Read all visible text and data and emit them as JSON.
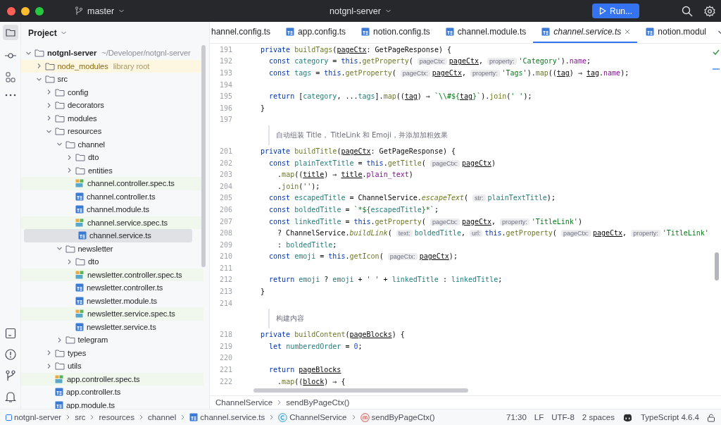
{
  "window": {
    "branch": "master",
    "project": "notgnl-server",
    "run_button": "Run..."
  },
  "project_panel": {
    "title": "Project",
    "tree": [
      {
        "name": "notgnl-server",
        "kind": "project",
        "hint": "~/Developer/notgnl-server",
        "expanded": true,
        "selected": false,
        "children": [
          {
            "name": "node_modules",
            "kind": "library",
            "hint": "library root",
            "expanded": false,
            "selected": false
          },
          {
            "name": "src",
            "kind": "folder",
            "expanded": true,
            "selected": false,
            "children": [
              {
                "name": "config",
                "kind": "folder",
                "expanded": false,
                "selected": false
              },
              {
                "name": "decorators",
                "kind": "folder",
                "expanded": false,
                "selected": false
              },
              {
                "name": "modules",
                "kind": "folder",
                "expanded": false,
                "selected": false
              },
              {
                "name": "resources",
                "kind": "folder",
                "expanded": true,
                "selected": false,
                "children": [
                  {
                    "name": "channel",
                    "kind": "folder",
                    "expanded": true,
                    "selected": false,
                    "children": [
                      {
                        "name": "dto",
                        "kind": "folder",
                        "expanded": false,
                        "selected": false
                      },
                      {
                        "name": "entities",
                        "kind": "folder",
                        "expanded": false,
                        "selected": false
                      },
                      {
                        "name": "channel.controller.spec.ts",
                        "kind": "spec",
                        "selected": false
                      },
                      {
                        "name": "channel.controller.ts",
                        "kind": "ts",
                        "selected": false
                      },
                      {
                        "name": "channel.module.ts",
                        "kind": "ts",
                        "selected": false
                      },
                      {
                        "name": "channel.service.spec.ts",
                        "kind": "spec",
                        "selected": false
                      },
                      {
                        "name": "channel.service.ts",
                        "kind": "ts",
                        "selected": true
                      }
                    ]
                  },
                  {
                    "name": "newsletter",
                    "kind": "folder",
                    "expanded": true,
                    "selected": false,
                    "children": [
                      {
                        "name": "dto",
                        "kind": "folder",
                        "expanded": false,
                        "selected": false
                      },
                      {
                        "name": "newsletter.controller.spec.ts",
                        "kind": "spec",
                        "selected": false
                      },
                      {
                        "name": "newsletter.controller.ts",
                        "kind": "ts",
                        "selected": false
                      },
                      {
                        "name": "newsletter.module.ts",
                        "kind": "ts",
                        "selected": false
                      },
                      {
                        "name": "newsletter.service.spec.ts",
                        "kind": "spec",
                        "selected": false
                      },
                      {
                        "name": "newsletter.service.ts",
                        "kind": "ts",
                        "selected": false
                      }
                    ]
                  },
                  {
                    "name": "telegram",
                    "kind": "folder",
                    "expanded": false,
                    "selected": false
                  }
                ]
              },
              {
                "name": "types",
                "kind": "folder",
                "expanded": false,
                "selected": false
              },
              {
                "name": "utils",
                "kind": "folder",
                "expanded": false,
                "selected": false
              },
              {
                "name": "app.controller.spec.ts",
                "kind": "spec",
                "selected": false
              },
              {
                "name": "app.controller.ts",
                "kind": "ts",
                "selected": false
              },
              {
                "name": "app.module.ts",
                "kind": "ts",
                "selected": false
              }
            ]
          }
        ]
      }
    ]
  },
  "editor": {
    "tabs": [
      {
        "label": "hannel.config.ts",
        "kind": "plain",
        "selected": false
      },
      {
        "label": "app.config.ts",
        "kind": "ts",
        "selected": false
      },
      {
        "label": "notion.config.ts",
        "kind": "ts",
        "selected": false
      },
      {
        "label": "channel.module.ts",
        "kind": "ts",
        "selected": false
      },
      {
        "label": "channel.service.ts",
        "kind": "ts",
        "selected": true
      },
      {
        "label": "notion.modul",
        "kind": "ts",
        "selected": false
      }
    ],
    "lines": [
      {
        "kind": "code",
        "number": "191",
        "tokens": [
          {
            "kind": "keyword",
            "text": "private "
          },
          {
            "kind": "method",
            "text": "buildTags"
          },
          {
            "kind": "plain",
            "text": "("
          },
          {
            "kind": "parameter",
            "text": "pageCtx"
          },
          {
            "kind": "plain",
            "text": ": GetPageResponse) {"
          }
        ]
      },
      {
        "kind": "code",
        "number": "192",
        "tokens": [
          {
            "kind": "keyword",
            "text": "  const "
          },
          {
            "kind": "variable",
            "text": "category"
          },
          {
            "kind": "plain",
            "text": " = "
          },
          {
            "kind": "keyword",
            "text": "this"
          },
          {
            "kind": "plain",
            "text": "."
          },
          {
            "kind": "method",
            "text": "getProperty"
          },
          {
            "kind": "plain",
            "text": "( "
          },
          {
            "kind": "hint",
            "text": "pageCtx:"
          },
          {
            "kind": "parameter",
            "text": "pageCtx"
          },
          {
            "kind": "plain",
            "text": ", "
          },
          {
            "kind": "hint",
            "text": "property:"
          },
          {
            "kind": "string",
            "text": "'Category'"
          },
          {
            "kind": "plain",
            "text": ")."
          },
          {
            "kind": "member",
            "text": "name"
          },
          {
            "kind": "plain",
            "text": ";"
          }
        ]
      },
      {
        "kind": "code",
        "number": "193",
        "tokens": [
          {
            "kind": "keyword",
            "text": "  const "
          },
          {
            "kind": "variable",
            "text": "tags"
          },
          {
            "kind": "plain",
            "text": " = "
          },
          {
            "kind": "keyword",
            "text": "this"
          },
          {
            "kind": "plain",
            "text": "."
          },
          {
            "kind": "method",
            "text": "getProperty"
          },
          {
            "kind": "plain",
            "text": "( "
          },
          {
            "kind": "hint",
            "text": "pageCtx:"
          },
          {
            "kind": "parameter",
            "text": "pageCtx"
          },
          {
            "kind": "plain",
            "text": ", "
          },
          {
            "kind": "hint",
            "text": "property:"
          },
          {
            "kind": "string",
            "text": "'Tags'"
          },
          {
            "kind": "plain",
            "text": ")."
          },
          {
            "kind": "method",
            "text": "map"
          },
          {
            "kind": "plain",
            "text": "(("
          },
          {
            "kind": "parameter",
            "text": "tag"
          },
          {
            "kind": "plain",
            "text": ") ⇒ "
          },
          {
            "kind": "parameter",
            "text": "tag"
          },
          {
            "kind": "plain",
            "text": "."
          },
          {
            "kind": "member",
            "text": "name"
          },
          {
            "kind": "plain",
            "text": ");"
          }
        ]
      },
      {
        "kind": "code",
        "number": "194"
      },
      {
        "kind": "code",
        "number": "195",
        "tokens": [
          {
            "kind": "keyword",
            "text": "  return "
          },
          {
            "kind": "plain",
            "text": "["
          },
          {
            "kind": "variable",
            "text": "category"
          },
          {
            "kind": "plain",
            "text": ", ..."
          },
          {
            "kind": "variable",
            "text": "tags"
          },
          {
            "kind": "plain",
            "text": "]."
          },
          {
            "kind": "method",
            "text": "map"
          },
          {
            "kind": "plain",
            "text": "(("
          },
          {
            "kind": "parameter",
            "text": "tag"
          },
          {
            "kind": "plain",
            "text": ") ⇒ "
          },
          {
            "kind": "string",
            "text": "`\\\\#${"
          },
          {
            "kind": "parameter",
            "text": "tag"
          },
          {
            "kind": "string",
            "text": "}`"
          },
          {
            "kind": "plain",
            "text": ")."
          },
          {
            "kind": "method",
            "text": "join"
          },
          {
            "kind": "plain",
            "text": "("
          },
          {
            "kind": "string",
            "text": "' '"
          },
          {
            "kind": "plain",
            "text": ");"
          }
        ]
      },
      {
        "kind": "code",
        "number": "196",
        "tokens": [
          {
            "kind": "plain",
            "text": "}"
          }
        ]
      },
      {
        "kind": "code",
        "number": "197"
      },
      {
        "kind": "doc",
        "text": "自动组装 Title， TitleLink 和 Emoji，并添加加粗效果"
      },
      {
        "kind": "code",
        "number": "201",
        "tokens": [
          {
            "kind": "keyword",
            "text": "private "
          },
          {
            "kind": "method",
            "text": "buildTitle"
          },
          {
            "kind": "plain",
            "text": "("
          },
          {
            "kind": "parameter",
            "text": "pageCtx"
          },
          {
            "kind": "plain",
            "text": ": GetPageResponse) {"
          }
        ]
      },
      {
        "kind": "code",
        "number": "202",
        "tokens": [
          {
            "kind": "keyword",
            "text": "  const "
          },
          {
            "kind": "variable",
            "text": "plainTextTitle"
          },
          {
            "kind": "plain",
            "text": " = "
          },
          {
            "kind": "keyword",
            "text": "this"
          },
          {
            "kind": "plain",
            "text": "."
          },
          {
            "kind": "method",
            "text": "getTitle"
          },
          {
            "kind": "plain",
            "text": "( "
          },
          {
            "kind": "hint",
            "text": "pageCtx:"
          },
          {
            "kind": "parameter",
            "text": "pageCtx"
          },
          {
            "kind": "plain",
            "text": ")"
          }
        ]
      },
      {
        "kind": "code",
        "number": "203",
        "tokens": [
          {
            "kind": "plain",
            "text": "    ."
          },
          {
            "kind": "method",
            "text": "map"
          },
          {
            "kind": "plain",
            "text": "(("
          },
          {
            "kind": "parameter",
            "text": "title"
          },
          {
            "kind": "plain",
            "text": ") ⇒ "
          },
          {
            "kind": "parameter",
            "text": "title"
          },
          {
            "kind": "plain",
            "text": "."
          },
          {
            "kind": "member",
            "text": "plain_text"
          },
          {
            "kind": "plain",
            "text": ")"
          }
        ]
      },
      {
        "kind": "code",
        "number": "204",
        "tokens": [
          {
            "kind": "plain",
            "text": "    ."
          },
          {
            "kind": "method",
            "text": "join"
          },
          {
            "kind": "plain",
            "text": "("
          },
          {
            "kind": "string",
            "text": "''"
          },
          {
            "kind": "plain",
            "text": ");"
          }
        ]
      },
      {
        "kind": "code",
        "number": "205",
        "tokens": [
          {
            "kind": "keyword",
            "text": "  const "
          },
          {
            "kind": "variable",
            "text": "escapedTitle"
          },
          {
            "kind": "plain",
            "text": " = ChannelService."
          },
          {
            "kind": "static",
            "text": "escapeText"
          },
          {
            "kind": "plain",
            "text": "( "
          },
          {
            "kind": "hint",
            "text": "str:"
          },
          {
            "kind": "variable",
            "text": "plainTextTitle"
          },
          {
            "kind": "plain",
            "text": ");"
          }
        ]
      },
      {
        "kind": "code",
        "number": "206",
        "tokens": [
          {
            "kind": "keyword",
            "text": "  const "
          },
          {
            "kind": "variable",
            "text": "boldedTitle"
          },
          {
            "kind": "plain",
            "text": " = "
          },
          {
            "kind": "string",
            "text": "`*${"
          },
          {
            "kind": "variable",
            "text": "escapedTitle"
          },
          {
            "kind": "string",
            "text": "}*`"
          },
          {
            "kind": "plain",
            "text": ";"
          }
        ]
      },
      {
        "kind": "code",
        "number": "207",
        "tokens": [
          {
            "kind": "keyword",
            "text": "  const "
          },
          {
            "kind": "variable",
            "text": "linkedTitle"
          },
          {
            "kind": "plain",
            "text": " = "
          },
          {
            "kind": "keyword",
            "text": "this"
          },
          {
            "kind": "plain",
            "text": "."
          },
          {
            "kind": "method",
            "text": "getProperty"
          },
          {
            "kind": "plain",
            "text": "( "
          },
          {
            "kind": "hint",
            "text": "pageCtx:"
          },
          {
            "kind": "parameter",
            "text": "pageCtx"
          },
          {
            "kind": "plain",
            "text": ", "
          },
          {
            "kind": "hint",
            "text": "property:"
          },
          {
            "kind": "string",
            "text": "'TitleLink'"
          },
          {
            "kind": "plain",
            "text": ")"
          }
        ]
      },
      {
        "kind": "code",
        "number": "208",
        "tokens": [
          {
            "kind": "plain",
            "text": "    ? ChannelService."
          },
          {
            "kind": "static",
            "text": "buildLink"
          },
          {
            "kind": "plain",
            "text": "( "
          },
          {
            "kind": "hint",
            "text": "text:"
          },
          {
            "kind": "variable",
            "text": "boldedTitle"
          },
          {
            "kind": "plain",
            "text": ", "
          },
          {
            "kind": "hint",
            "text": "url:"
          },
          {
            "kind": "keyword",
            "text": "this"
          },
          {
            "kind": "plain",
            "text": "."
          },
          {
            "kind": "method",
            "text": "getProperty"
          },
          {
            "kind": "plain",
            "text": "( "
          },
          {
            "kind": "hint",
            "text": "pageCtx:"
          },
          {
            "kind": "parameter",
            "text": "pageCtx"
          },
          {
            "kind": "plain",
            "text": ", "
          },
          {
            "kind": "hint",
            "text": "property:"
          },
          {
            "kind": "string",
            "text": "'TitleLink'"
          }
        ]
      },
      {
        "kind": "code",
        "number": "209",
        "tokens": [
          {
            "kind": "plain",
            "text": "    : "
          },
          {
            "kind": "variable",
            "text": "boldedTitle"
          },
          {
            "kind": "plain",
            "text": ";"
          }
        ]
      },
      {
        "kind": "code",
        "number": "210",
        "tokens": [
          {
            "kind": "keyword",
            "text": "  const "
          },
          {
            "kind": "variable",
            "text": "emoji"
          },
          {
            "kind": "plain",
            "text": " = "
          },
          {
            "kind": "keyword",
            "text": "this"
          },
          {
            "kind": "plain",
            "text": "."
          },
          {
            "kind": "method",
            "text": "getIcon"
          },
          {
            "kind": "plain",
            "text": "( "
          },
          {
            "kind": "hint",
            "text": "pageCtx:"
          },
          {
            "kind": "parameter",
            "text": "pageCtx"
          },
          {
            "kind": "plain",
            "text": ");"
          }
        ]
      },
      {
        "kind": "code",
        "number": "211"
      },
      {
        "kind": "code",
        "number": "212",
        "tokens": [
          {
            "kind": "keyword",
            "text": "  return "
          },
          {
            "kind": "variable",
            "text": "emoji"
          },
          {
            "kind": "plain",
            "text": " ? "
          },
          {
            "kind": "variable",
            "text": "emoji"
          },
          {
            "kind": "plain",
            "text": " + "
          },
          {
            "kind": "string",
            "text": "' '"
          },
          {
            "kind": "plain",
            "text": " + "
          },
          {
            "kind": "variable",
            "text": "linkedTitle"
          },
          {
            "kind": "plain",
            "text": " : "
          },
          {
            "kind": "variable",
            "text": "linkedTitle"
          },
          {
            "kind": "plain",
            "text": ";"
          }
        ]
      },
      {
        "kind": "code",
        "number": "213",
        "tokens": [
          {
            "kind": "plain",
            "text": "}"
          }
        ]
      },
      {
        "kind": "code",
        "number": "214"
      },
      {
        "kind": "doc",
        "text": "构建内容"
      },
      {
        "kind": "code",
        "number": "218",
        "tokens": [
          {
            "kind": "keyword",
            "text": "private "
          },
          {
            "kind": "method",
            "text": "buildContent"
          },
          {
            "kind": "plain",
            "text": "("
          },
          {
            "kind": "parameter",
            "text": "pageBlocks"
          },
          {
            "kind": "plain",
            "text": ") {"
          }
        ]
      },
      {
        "kind": "code",
        "number": "219",
        "tokens": [
          {
            "kind": "keyword",
            "text": "  let "
          },
          {
            "kind": "variable",
            "text": "numberedOrder"
          },
          {
            "kind": "plain",
            "text": " = "
          },
          {
            "kind": "number",
            "text": "0"
          },
          {
            "kind": "plain",
            "text": ";"
          }
        ]
      },
      {
        "kind": "code",
        "number": "220"
      },
      {
        "kind": "code",
        "number": "221",
        "tokens": [
          {
            "kind": "keyword",
            "text": "  return "
          },
          {
            "kind": "parameter",
            "text": "pageBlocks"
          }
        ]
      },
      {
        "kind": "code",
        "number": "222",
        "tokens": [
          {
            "kind": "plain",
            "text": "    ."
          },
          {
            "kind": "method",
            "text": "map"
          },
          {
            "kind": "plain",
            "text": "(("
          },
          {
            "kind": "parameter",
            "text": "block"
          },
          {
            "kind": "plain",
            "text": ") ⇒ {"
          }
        ]
      }
    ],
    "breadcrumb": [
      "ChannelService",
      "sendByPageCtx()"
    ]
  },
  "status_bar": {
    "path": [
      {
        "kind": "project",
        "label": "notgnl-server"
      },
      {
        "kind": "folder",
        "label": "src"
      },
      {
        "kind": "folder",
        "label": "resources"
      },
      {
        "kind": "folder",
        "label": "channel"
      },
      {
        "kind": "ts",
        "label": "channel.service.ts"
      },
      {
        "kind": "class",
        "label": "ChannelService"
      },
      {
        "kind": "method",
        "label": "sendByPageCtx()"
      }
    ],
    "position": "71:30",
    "line_ending": "LF",
    "encoding": "UTF-8",
    "indent": "2 spaces",
    "language": "TypeScript 4.6.4"
  }
}
